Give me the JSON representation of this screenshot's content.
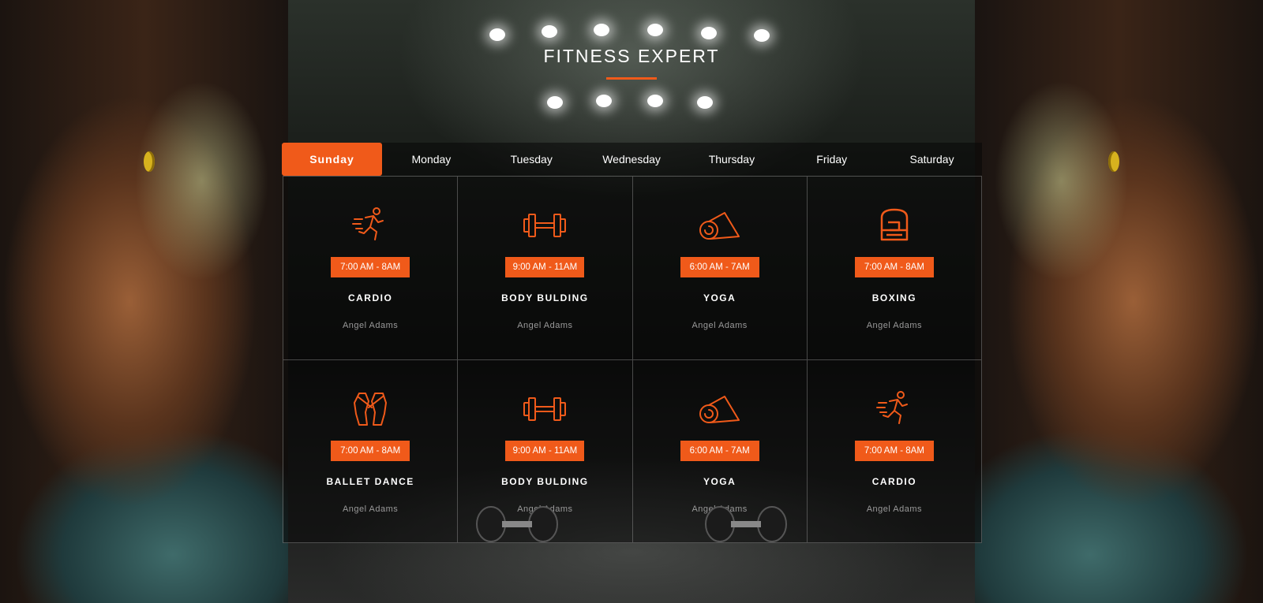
{
  "header": {
    "title": "FITNESS EXPERT"
  },
  "tabs": [
    {
      "label": "Sunday",
      "active": true
    },
    {
      "label": "Monday",
      "active": false
    },
    {
      "label": "Tuesday",
      "active": false
    },
    {
      "label": "Wednesday",
      "active": false
    },
    {
      "label": "Thursday",
      "active": false
    },
    {
      "label": "Friday",
      "active": false
    },
    {
      "label": "Saturday",
      "active": false
    }
  ],
  "classes": [
    {
      "icon": "running-icon",
      "time": "7:00 AM - 8AM",
      "name": "CARDIO",
      "trainer": "Angel Adams"
    },
    {
      "icon": "dumbbell-icon",
      "time": "9:00 AM - 11AM",
      "name": "BODY BULDING",
      "trainer": "Angel Adams"
    },
    {
      "icon": "yoga-mat-icon",
      "time": "6:00 AM - 7AM",
      "name": "YOGA",
      "trainer": "Angel Adams"
    },
    {
      "icon": "boxing-glove-icon",
      "time": "7:00 AM - 8AM",
      "name": "BOXING",
      "trainer": "Angel Adams"
    },
    {
      "icon": "ballet-shoes-icon",
      "time": "7:00 AM - 8AM",
      "name": "BALLET DANCE",
      "trainer": "Angel Adams"
    },
    {
      "icon": "dumbbell-icon",
      "time": "9:00 AM - 11AM",
      "name": "BODY BULDING",
      "trainer": "Angel Adams"
    },
    {
      "icon": "yoga-mat-icon",
      "time": "6:00 AM - 7AM",
      "name": "YOGA",
      "trainer": "Angel Adams"
    },
    {
      "icon": "running-icon",
      "time": "7:00 AM - 8AM",
      "name": "CARDIO",
      "trainer": "Angel Adams"
    }
  ],
  "colors": {
    "accent": "#f05a1a",
    "text": "#ffffff",
    "muted": "#9a9a9a"
  }
}
